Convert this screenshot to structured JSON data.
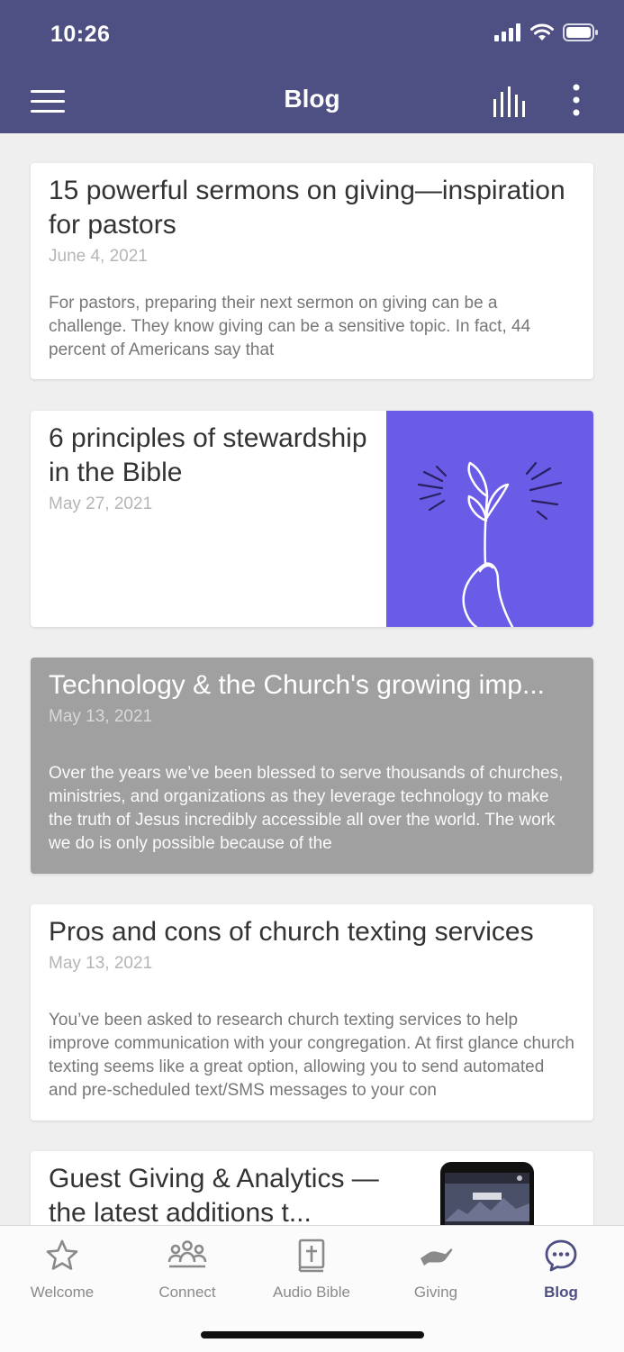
{
  "status_bar": {
    "time": "10:26"
  },
  "app_bar": {
    "title": "Blog",
    "menu_icon": "hamburger-menu-icon",
    "stats_icon": "bar-chart-icon",
    "more_icon": "more-vertical-icon"
  },
  "posts": [
    {
      "title": "15 powerful sermons on giving—inspiration for pastors",
      "date": "June 4, 2021",
      "excerpt": " For pastors, preparing their next sermon on giving can be a challenge. They know giving can be a sensitive topic. In fact, 44 percent of Americans say that"
    },
    {
      "title": "6 principles of stewardship in the Bible",
      "date": "May 27, 2021",
      "image": "hand-holding-sprout-illustration"
    },
    {
      "title": "Technology & the Church's growing imp...",
      "date": "May 13, 2021",
      "excerpt": " Over the years we’ve been blessed to serve thousands of churches, ministries, and organizations as they leverage technology to make the truth of Jesus incredibly accessible all over the world. The work we do is only possible because of the"
    },
    {
      "title": "Pros and cons of church texting services",
      "date": "May 13, 2021",
      "excerpt": " You’ve been asked to research church texting services to help improve communication with your congregation. At first glance church texting seems like a great option, allowing you to send automated and pre-scheduled text/SMS messages to your con"
    },
    {
      "title": "Guest Giving & Analytics —the latest additions t...",
      "image": "phone-app-screenshot"
    }
  ],
  "tabs": [
    {
      "label": "Welcome",
      "icon": "star-icon"
    },
    {
      "label": "Connect",
      "icon": "people-group-icon"
    },
    {
      "label": "Audio Bible",
      "icon": "bible-cross-icon"
    },
    {
      "label": "Giving",
      "icon": "giving-hand-icon"
    },
    {
      "label": "Blog",
      "icon": "chat-bubble-icon",
      "active": true
    }
  ],
  "colors": {
    "brand": "#4e4f82",
    "illustration_bg": "#6b5ce7"
  }
}
